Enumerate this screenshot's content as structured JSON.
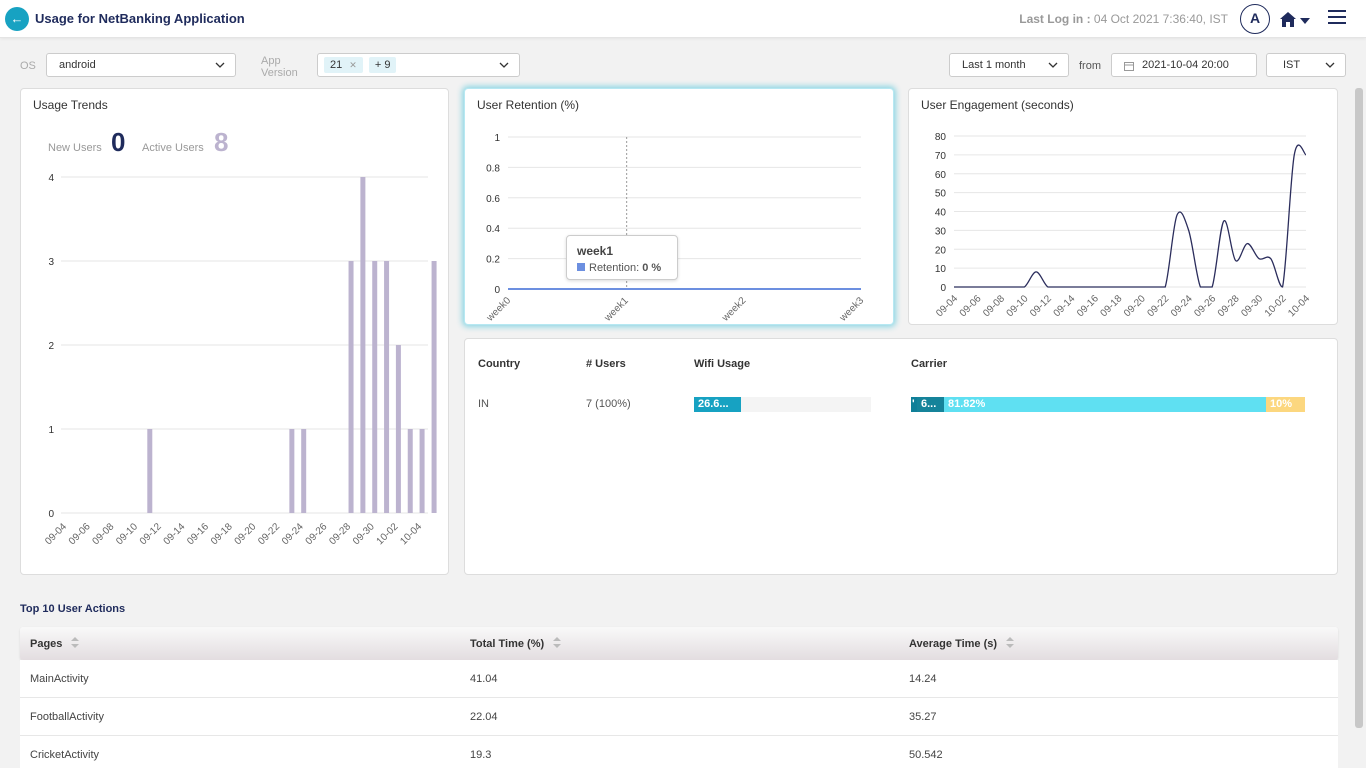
{
  "header": {
    "title": "Usage for NetBanking Application",
    "last_login_label": "Last Log in :",
    "last_login_value": "04 Oct 2021 7:36:40, IST",
    "avatar_letter": "A"
  },
  "filters": {
    "os_label": "OS",
    "os_value": "android",
    "app_version_label_1": "App",
    "app_version_label_2": "Version",
    "app_version_tag": "21",
    "app_version_more": "+ 9",
    "range_value": "Last 1 month",
    "from_label": "from",
    "from_value": "2021-10-04 20:00",
    "timezone_value": "IST"
  },
  "usage_trends": {
    "title": "Usage Trends",
    "new_users_label": "New Users",
    "new_users_value": "0",
    "active_users_label": "Active Users",
    "active_users_value": "8"
  },
  "retention": {
    "title": "User Retention (%)",
    "tooltip_title": "week1",
    "tooltip_label": "Retention:",
    "tooltip_value": "0 %"
  },
  "engagement": {
    "title": "User Engagement (seconds)"
  },
  "country_table": {
    "headers": [
      "Country",
      "# Users",
      "Wifi Usage",
      "Carrier"
    ],
    "rows": [
      {
        "country": "IN",
        "users": "7 (100%)",
        "wifi_label": "26.6...",
        "wifi_fraction": 0.266,
        "carrier_labels": [
          "'",
          "6...",
          "81.82%",
          "10%"
        ]
      }
    ]
  },
  "actions": {
    "title": "Top 10 User Actions",
    "headers": [
      "Pages",
      "Total Time (%)",
      "Average Time (s)"
    ],
    "rows": [
      [
        "MainActivity",
        "41.04",
        "14.24"
      ],
      [
        "FootballActivity",
        "22.04",
        "35.27"
      ],
      [
        "CricketActivity",
        "19.3",
        "50.542"
      ]
    ]
  },
  "colors": {
    "accent": "#17a2c2",
    "navy": "#1f2b5c",
    "bar_lavender": "#bcb3cf",
    "carrier_dark": "#0f7f98",
    "carrier_mid": "#15839a",
    "carrier_light": "#5fe0f2",
    "carrier_yellow": "#fcd77f"
  },
  "chart_data": [
    {
      "type": "bar",
      "title": "Usage Trends",
      "xlabel": "",
      "ylabel": "",
      "ylim": [
        0,
        4
      ],
      "yticks": [
        "0",
        "1",
        "2",
        "3",
        "4"
      ],
      "xticks": [
        "09-04",
        "09-06",
        "09-08",
        "09-10",
        "09-12",
        "09-14",
        "09-16",
        "09-18",
        "09-20",
        "09-22",
        "09-24",
        "09-26",
        "09-28",
        "09-30",
        "10-02",
        "10-04"
      ],
      "categories": [
        "09-04",
        "09-05",
        "09-06",
        "09-07",
        "09-08",
        "09-09",
        "09-10",
        "09-11",
        "09-12",
        "09-13",
        "09-14",
        "09-15",
        "09-16",
        "09-17",
        "09-18",
        "09-19",
        "09-20",
        "09-21",
        "09-22",
        "09-23",
        "09-24",
        "09-25",
        "09-26",
        "09-27",
        "09-28",
        "09-29",
        "09-30",
        "10-01",
        "10-02",
        "10-03",
        "10-04"
      ],
      "values": [
        0,
        0,
        0,
        0,
        0,
        0,
        0,
        1,
        0,
        0,
        0,
        0,
        0,
        0,
        0,
        0,
        0,
        0,
        0,
        1,
        1,
        0,
        0,
        0,
        3,
        4,
        3,
        3,
        2,
        1,
        1
      ],
      "extra_last_bar": 3,
      "grid": true
    },
    {
      "type": "line",
      "title": "User Retention (%)",
      "categories": [
        "week0",
        "week1",
        "week2",
        "week3"
      ],
      "values": [
        0,
        0,
        0,
        0
      ],
      "ylim": [
        0,
        1
      ],
      "yticks": [
        "0",
        "0.2",
        "0.4",
        "0.6",
        "0.8",
        "1"
      ],
      "grid": true
    },
    {
      "type": "line",
      "title": "User Engagement (seconds)",
      "xticks": [
        "09-04",
        "09-06",
        "09-08",
        "09-10",
        "09-12",
        "09-14",
        "09-16",
        "09-18",
        "09-20",
        "09-22",
        "09-24",
        "09-26",
        "09-28",
        "09-30",
        "10-02",
        "10-04"
      ],
      "series": [
        {
          "x": [
            "09-04",
            "09-05",
            "09-06",
            "09-07",
            "09-08",
            "09-09",
            "09-10",
            "09-11",
            "09-12",
            "09-13",
            "09-14",
            "09-15",
            "09-16",
            "09-17",
            "09-18",
            "09-19",
            "09-20",
            "09-21",
            "09-22",
            "09-23",
            "09-24",
            "09-25",
            "09-26",
            "09-27",
            "09-28",
            "09-29",
            "09-30",
            "10-01",
            "10-02",
            "10-03",
            "10-04"
          ],
          "values": [
            0,
            0,
            0,
            0,
            0,
            0,
            0,
            8,
            0,
            0,
            0,
            0,
            0,
            0,
            0,
            0,
            0,
            0,
            0,
            38,
            30,
            0,
            0,
            35,
            14,
            23,
            15,
            15,
            0,
            70,
            70
          ]
        }
      ],
      "ylim": [
        0,
        80
      ],
      "yticks": [
        "0",
        "10",
        "20",
        "30",
        "40",
        "50",
        "60",
        "70",
        "80"
      ],
      "grid": true
    }
  ]
}
